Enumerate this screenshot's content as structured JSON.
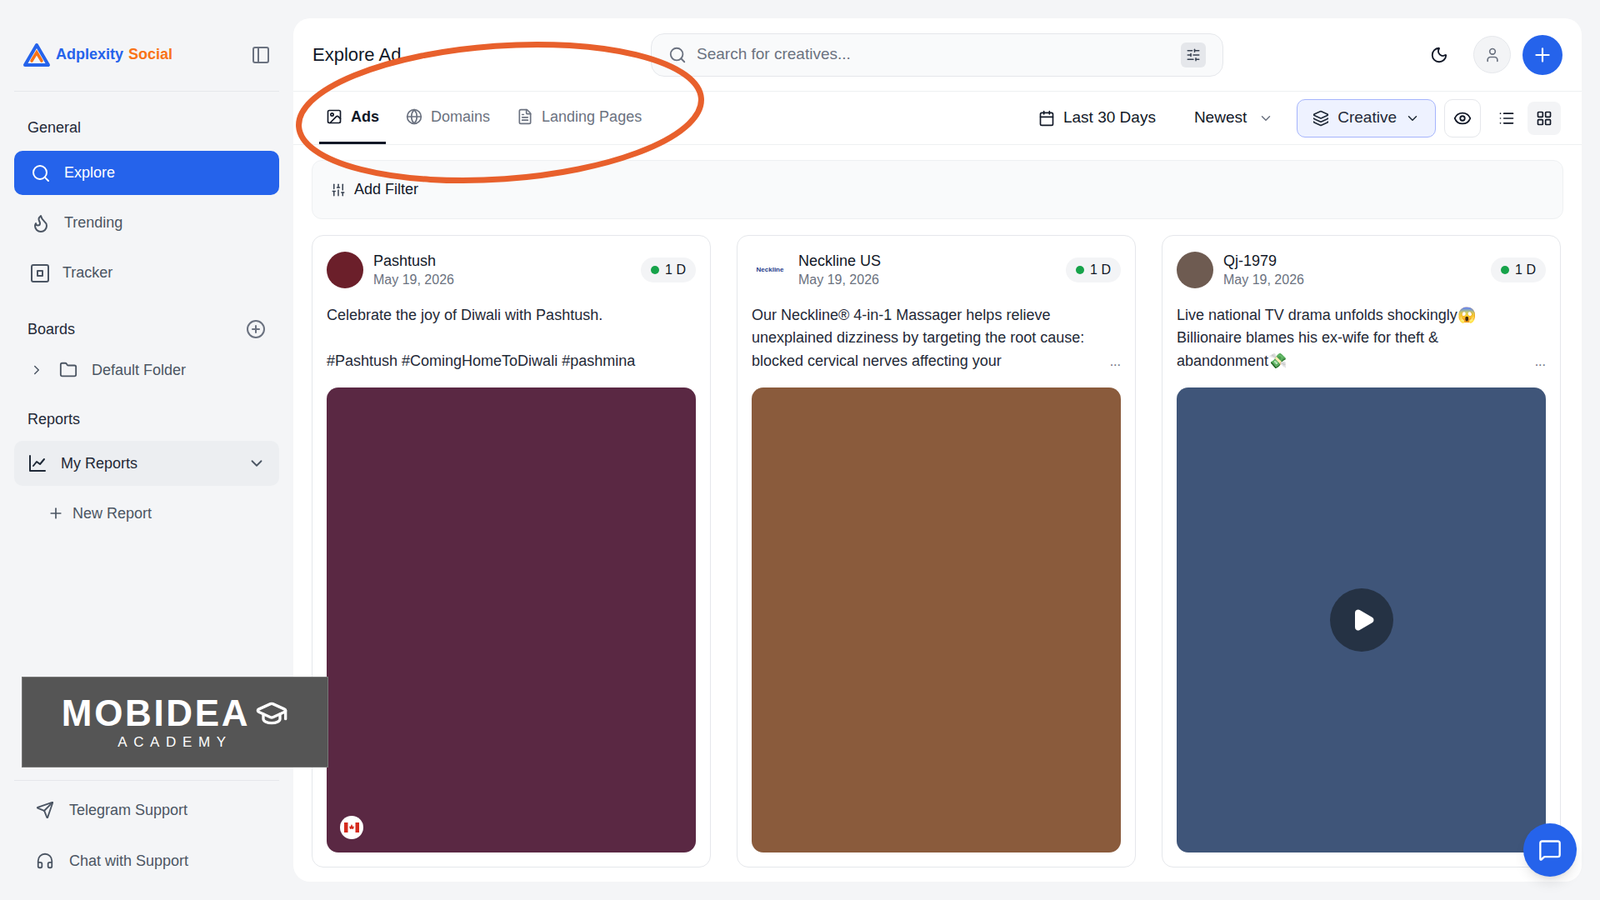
{
  "brand": {
    "name": "Adplexity",
    "product": "Social"
  },
  "sidebar": {
    "general": {
      "title": "General",
      "items": [
        {
          "label": "Explore",
          "kind": "explore",
          "selected": true
        },
        {
          "label": "Trending",
          "kind": "trending",
          "selected": false
        },
        {
          "label": "Tracker",
          "kind": "tracker",
          "selected": false
        }
      ]
    },
    "boards": {
      "title": "Boards",
      "folders": [
        {
          "label": "Default Folder",
          "expanded": false
        }
      ]
    },
    "reports": {
      "title": "Reports",
      "items": [
        {
          "label": "My Reports",
          "expanded": true,
          "highlighted": true
        }
      ],
      "new_report": "New Report"
    },
    "footer": [
      {
        "label": "Telegram Support",
        "kind": "telegram"
      },
      {
        "label": "Chat with Support",
        "kind": "chat"
      }
    ]
  },
  "watermark": {
    "name": "MOBIDEA",
    "subtitle": "ACADEMY"
  },
  "header": {
    "title": "Explore Ad",
    "search_placeholder": "Search for creatives..."
  },
  "tabs": [
    {
      "label": "Ads",
      "kind": "ads",
      "selected": true
    },
    {
      "label": "Domains",
      "kind": "domains",
      "selected": false
    },
    {
      "label": "Landing Pages",
      "kind": "pages",
      "selected": false
    }
  ],
  "toolbar": {
    "date_range": "Last 30 Days",
    "sort": "Newest",
    "view_mode": "Creative",
    "layouts": [
      {
        "kind": "list",
        "selected": false
      },
      {
        "kind": "grid",
        "selected": true
      }
    ]
  },
  "filter": {
    "label": "Add Filter"
  },
  "cards": [
    {
      "advertiser": "Pashtush",
      "date": "May 19, 2026",
      "age": "1 D",
      "active": true,
      "text": "Celebrate the joy of Diwali with Pashtush.\n\n#Pashtush #ComingHomeToDiwali #pashmina",
      "more": "",
      "media": "image",
      "flag": true,
      "avatar_text": ""
    },
    {
      "advertiser": "Neckline US",
      "date": "May 19, 2026",
      "age": "1 D",
      "active": true,
      "text": "Our Neckline® 4-in-1 Massager helps relieve unexplained dizziness by targeting the root cause: blocked cervical nerves affecting your",
      "more": "...",
      "media": "image",
      "flag": false,
      "avatar_text": "Neckline"
    },
    {
      "advertiser": "Qj-1979",
      "date": "May 19, 2026",
      "age": "1 D",
      "active": true,
      "text": "Live national TV drama unfolds shockingly😱 Billionaire blames his ex-wife for theft & abandonment💸",
      "more": "...",
      "media": "video",
      "flag": false,
      "avatar_text": ""
    }
  ]
}
